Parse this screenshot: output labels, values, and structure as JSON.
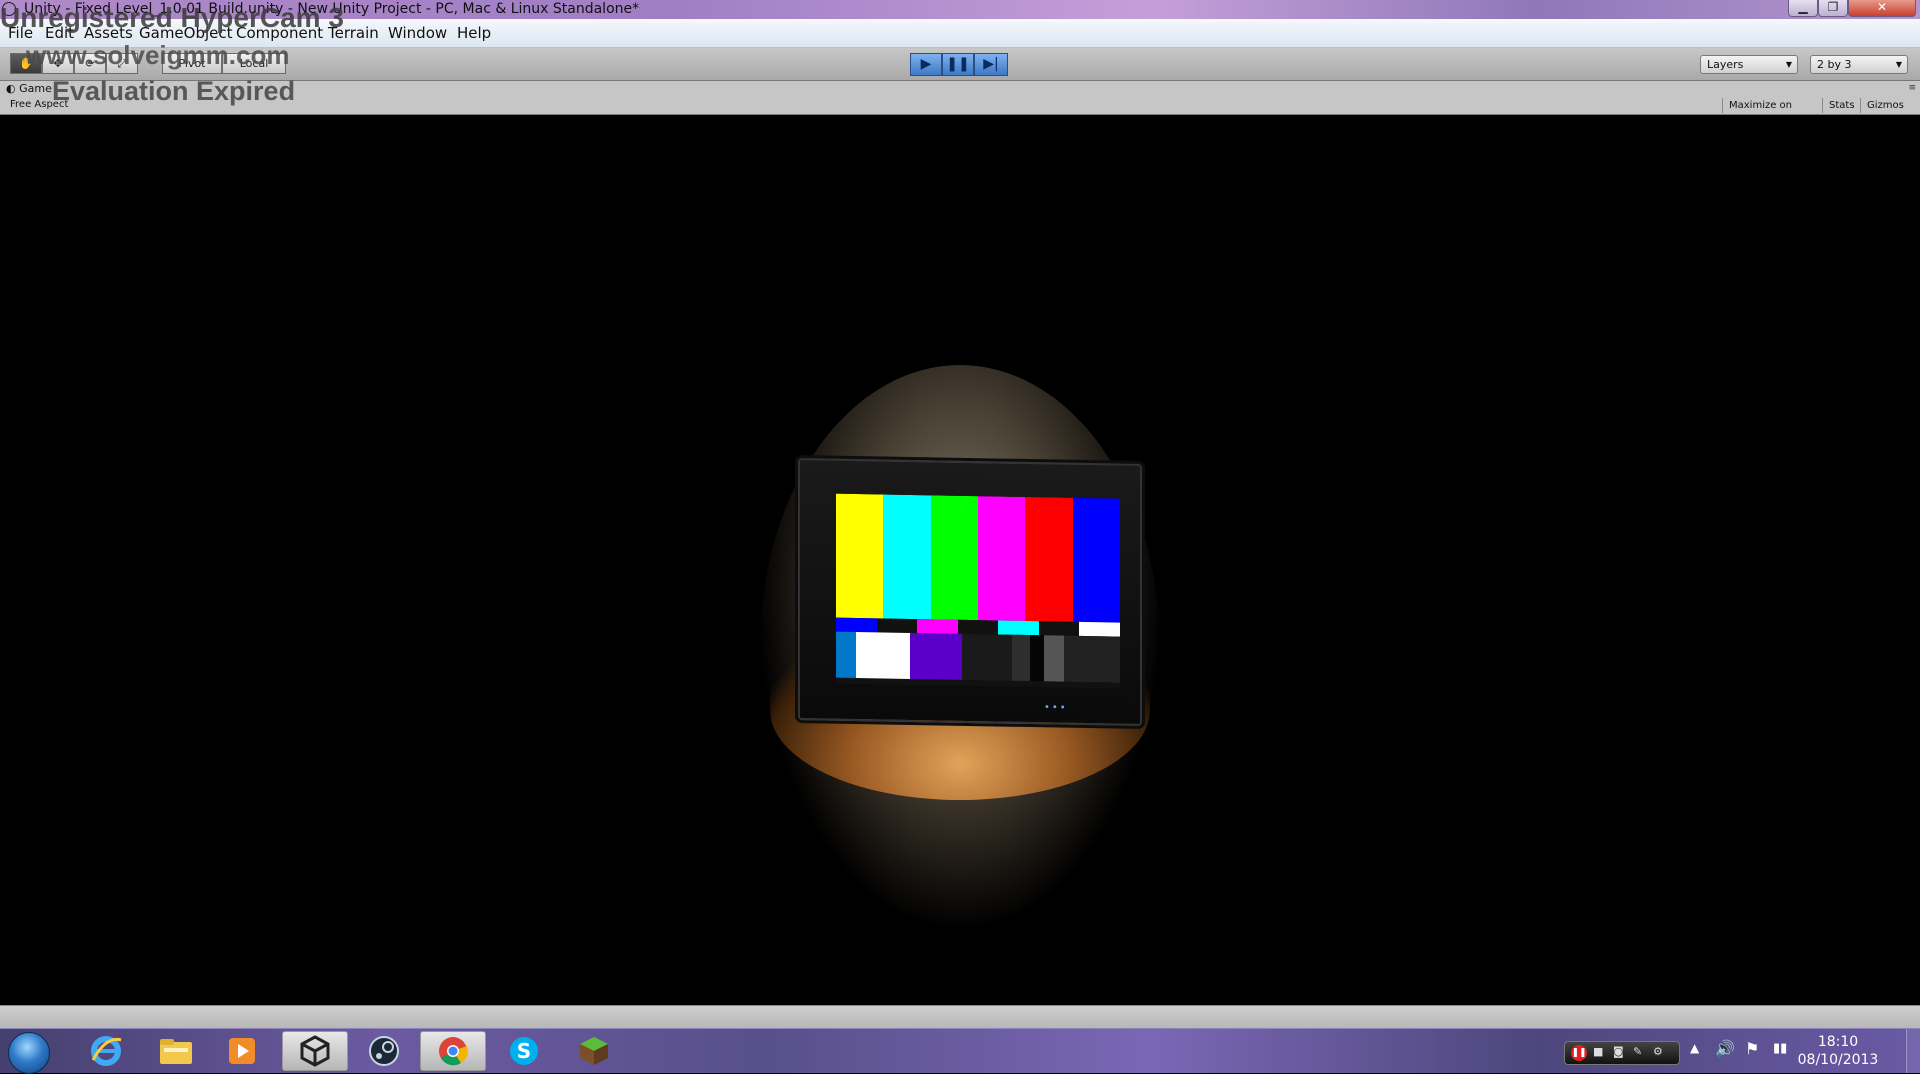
{
  "window": {
    "title": "Unity - Fixed Level_1.0.01 Build.unity - New Unity Project - PC, Mac & Linux Standalone*",
    "min": "▁",
    "max": "❐",
    "close": "✕"
  },
  "menu": [
    "File",
    "Edit",
    "Assets",
    "GameObject",
    "Component",
    "Terrain",
    "Window",
    "Help"
  ],
  "toolbar": {
    "tools": [
      "hand-icon",
      "move-icon",
      "rotate-icon",
      "scale-icon"
    ],
    "pivot_label": "Pivot",
    "local_label": "Local",
    "play": "▶",
    "pause": "❚❚",
    "step": "▶|",
    "layers_label": "Layers",
    "layout_label": "2 by 3"
  },
  "game_view": {
    "tab_label": "Game",
    "aspect_label": "Free Aspect",
    "maximize_label": "Maximize on Play",
    "stats_label": "Stats",
    "gizmos_label": "Gizmos"
  },
  "watermark": {
    "line1": "Unregistered HyperCam 3",
    "line2": "www.solveigmm.com",
    "line3": "Evaluation Expired"
  },
  "scene": {
    "bar_colors_top": [
      "#ffff00",
      "#00ffff",
      "#00ff00",
      "#ff00ff",
      "#ff0000",
      "#0000ff"
    ],
    "bar_colors_mid": [
      "#0000ff",
      "#111111",
      "#ff00ff",
      "#111111",
      "#00ffff",
      "#111111",
      "#ffffff"
    ],
    "bar_colors_low": [
      "#0077c8",
      "#ffffff",
      "#5a00c8",
      "#1a1a1a",
      "#2e2e2e",
      "#050505",
      "#555555",
      "#222222"
    ]
  },
  "taskbar": {
    "apps": [
      "start-orb",
      "internet-explorer-icon",
      "file-explorer-icon",
      "media-player-icon",
      "unity-icon",
      "steam-icon",
      "chrome-icon",
      "skype-icon",
      "minecraft-icon"
    ],
    "clock_time": "18:10",
    "clock_date": "08/10/2013"
  },
  "colors": {
    "titlebar": "#a07ec4",
    "taskbar": "#5a4f92",
    "play_active": "#3d78c6"
  }
}
